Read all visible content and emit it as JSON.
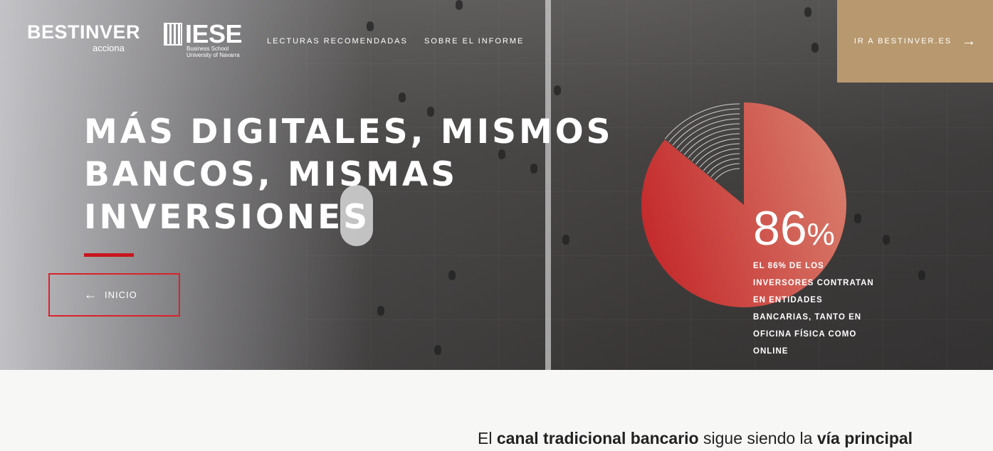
{
  "header": {
    "logo_main": "BESTINVER",
    "logo_sub": "acciona",
    "logo_iese": "IESE",
    "logo_iese_line1": "Business School",
    "logo_iese_line2": "University of Navarra",
    "nav": [
      "LECTURAS RECOMENDADAS",
      "SOBRE EL INFORME"
    ],
    "cta_label": "IR A BESTINVER.ES",
    "cta_color": "#b8996f"
  },
  "hero": {
    "title_lines": [
      "MÁS DIGITALES, MISMOS",
      "BANCOS, MISMAS",
      "INVERSIONES"
    ],
    "back_label": "INICIO",
    "accent_color": "#c8161d"
  },
  "stat": {
    "value": "86",
    "unit": "%",
    "percent": 86,
    "description": "EL 86% DE LOS INVERSORES CONTRATAN EN ENTIDADES BANCARIAS, TANTO EN OFICINA FÍSICA COMO ONLINE"
  },
  "body": {
    "t1": "El ",
    "b1": "canal tradicional bancario",
    "t2": " sigue siendo la ",
    "b2": "vía principal"
  }
}
